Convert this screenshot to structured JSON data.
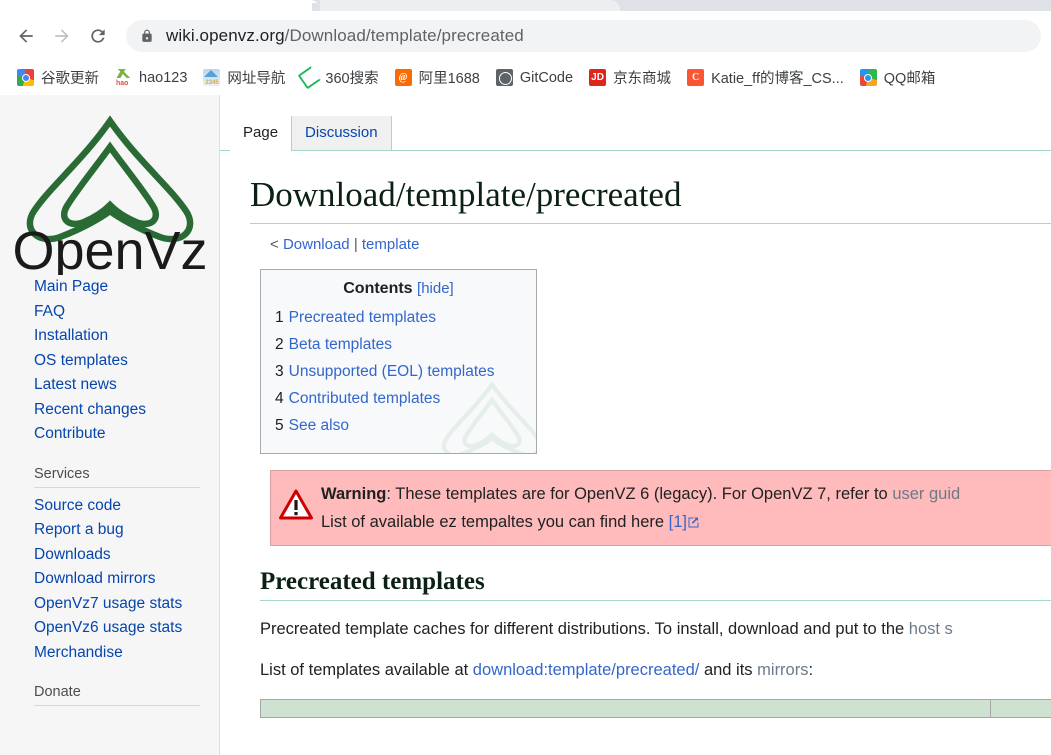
{
  "browser": {
    "nav": {
      "back": "back-arrow",
      "forward": "forward-arrow",
      "reload": "reload"
    },
    "omnibox": {
      "lock_icon": "lock-icon",
      "host": "wiki.openvz.org",
      "path": "/Download/template/precreated",
      "full_url": "wiki.openvz.org/Download/template/precreated"
    },
    "bookmarks": [
      {
        "label": "谷歌更新",
        "icon": "chrome-icon"
      },
      {
        "label": "hao123",
        "icon": "hao123-icon"
      },
      {
        "label": "网址导航",
        "icon": "2345-icon"
      },
      {
        "label": "360搜索",
        "icon": "360-icon"
      },
      {
        "label": "阿里1688",
        "icon": "alibaba-icon"
      },
      {
        "label": "GitCode",
        "icon": "gitcode-icon"
      },
      {
        "label": "京东商城",
        "icon": "jd-icon"
      },
      {
        "label": "Katie_ff的博客_CS...",
        "icon": "csdn-icon"
      },
      {
        "label": "QQ邮箱",
        "icon": "qqmail-icon"
      }
    ]
  },
  "sidebar": {
    "logo_alt": "OpenVz",
    "logo_text": "OpenVz",
    "nav_items": [
      {
        "label": "Main Page"
      },
      {
        "label": "FAQ"
      },
      {
        "label": "Installation"
      },
      {
        "label": "OS templates"
      },
      {
        "label": "Latest news"
      },
      {
        "label": "Recent changes"
      },
      {
        "label": "Contribute"
      }
    ],
    "services_heading": "Services",
    "services_items": [
      {
        "label": "Source code"
      },
      {
        "label": "Report a bug"
      },
      {
        "label": "Downloads"
      },
      {
        "label": "Download mirrors"
      },
      {
        "label": "OpenVz7 usage stats"
      },
      {
        "label": "OpenVz6 usage stats"
      },
      {
        "label": "Merchandise"
      }
    ],
    "donate_heading": "Donate"
  },
  "article": {
    "tabs": [
      {
        "label": "Page",
        "selected": true
      },
      {
        "label": "Discussion",
        "selected": false
      }
    ],
    "title": "Download/template/precreated",
    "subtitle_prefix": "< ",
    "subtitle_link1": "Download",
    "subtitle_sep": " | ",
    "subtitle_link2": "template",
    "toc": {
      "title": "Contents",
      "hide_label": "[hide]",
      "items": [
        {
          "num": "1",
          "label": "Precreated templates"
        },
        {
          "num": "2",
          "label": "Beta templates"
        },
        {
          "num": "3",
          "label": "Unsupported (EOL) templates"
        },
        {
          "num": "4",
          "label": "Contributed templates"
        },
        {
          "num": "5",
          "label": "See also"
        }
      ]
    },
    "warning": {
      "icon": "warning-triangle-icon",
      "label": "Warning",
      "line1_a": ": These templates are for OpenVZ 6 (legacy). For OpenVZ 7, refer to ",
      "line1_link": "user guid",
      "line2_a": "List of available ez tempaltes you can find here ",
      "line2_ref": "[1]",
      "line2_ext_icon": "external-link-icon"
    },
    "section_heading": "Precreated templates",
    "paragraph1_a": "Precreated template caches for different distributions. To install, download and put to the ",
    "paragraph1_link": "host s",
    "paragraph2_a": "List of templates available at ",
    "paragraph2_link": "download:template/precreated/",
    "paragraph2_b": " and its ",
    "paragraph2_link2": "mirrors",
    "paragraph2_c": ":"
  },
  "colors": {
    "link": "#3366cc",
    "sidebar_link": "#0645ad",
    "warning_bg": "#fbb",
    "wiki_green": "#a7d7c5",
    "table_header": "#cfe2d2",
    "heading": "#0b2113"
  }
}
